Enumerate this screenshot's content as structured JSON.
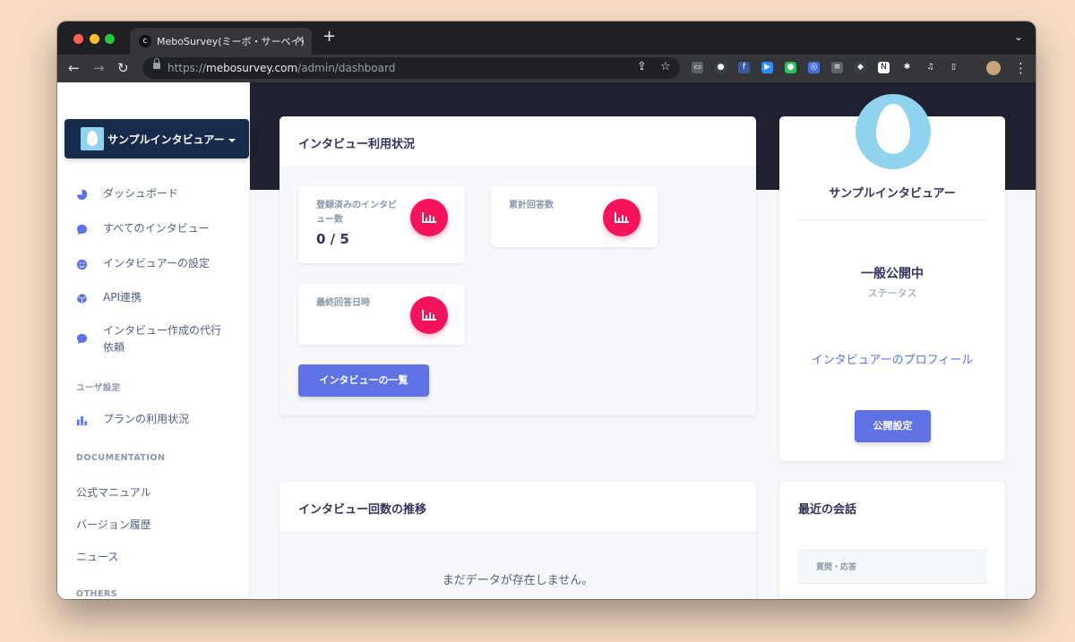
{
  "browser": {
    "tab_title": "MeboSurvey(ミーボ・サーベイ)",
    "tab_favicon": "c",
    "tab_close": "×",
    "new_tab": "+",
    "tab_search": "⌄",
    "url_scheme": "https://",
    "url_host": "mebosurvey.com",
    "url_path": "/admin/dashboard",
    "back_icon": "←",
    "forward_icon": "→",
    "reload_icon": "↻",
    "share_icon": "⇪",
    "star_icon": "☆",
    "menu_icon": "⋮",
    "extensions": [
      {
        "name": "screen-ext-icon",
        "glyph": "▭",
        "color": "#5f6368"
      },
      {
        "name": "circle-ext-icon",
        "glyph": "●",
        "color": "#3c4043"
      },
      {
        "name": "facebook-ext-icon",
        "glyph": "f",
        "color": "#3b5998"
      },
      {
        "name": "zoom-ext-icon",
        "glyph": "▶",
        "color": "#2d8cff"
      },
      {
        "name": "evernote-ext-icon",
        "glyph": "●",
        "color": "#2dbe60"
      },
      {
        "name": "swirl-ext-icon",
        "glyph": "◎",
        "color": "#4a6ee0"
      },
      {
        "name": "doc-ext-icon",
        "glyph": "≡",
        "color": "#5f6368"
      },
      {
        "name": "bot-ext-icon",
        "glyph": "◆",
        "color": "#3c4043"
      },
      {
        "name": "notion-ext-icon",
        "glyph": "N",
        "color": "#ffffff"
      },
      {
        "name": "puzzle-ext-icon",
        "glyph": "✱",
        "color": "#35363a"
      },
      {
        "name": "media-ext-icon",
        "glyph": "♫",
        "color": "#35363a"
      },
      {
        "name": "sidepanel-ext-icon",
        "glyph": "▯",
        "color": "#35363a"
      }
    ]
  },
  "sidebar": {
    "user_name": "サンプルインタビュアー",
    "items": [
      {
        "label": "ダッシュボード",
        "icon": "pie-chart-icon"
      },
      {
        "label": "すべてのインタビュー",
        "icon": "chat-bubble-icon"
      },
      {
        "label": "インタビュアーの設定",
        "icon": "smile-icon"
      },
      {
        "label": "API連携",
        "icon": "box-icon"
      },
      {
        "label": "インタビュー作成の代行\n依頼",
        "icon": "chat-bubble-icon"
      }
    ],
    "user_section": "ユーザ設定",
    "plan_item": {
      "label": "プランの利用状況",
      "icon": "bar-chart-icon"
    },
    "doc_section": "DOCUMENTATION",
    "doc_links": [
      "公式マニュアル",
      "バージョン履歴",
      "ニュース"
    ],
    "others_section": "OTHERS"
  },
  "usage_card": {
    "title": "インタビュー利用状況",
    "stats": [
      {
        "label": "登録済みのインタビュー数",
        "value": "0 / 5"
      },
      {
        "label": "累計回答数",
        "value": ""
      },
      {
        "label": "最終回答日時",
        "value": ""
      }
    ],
    "list_button": "インタビューの一覧"
  },
  "profile_card": {
    "name": "サンプルインタビュアー",
    "status": "一般公開中",
    "status_label": "ステータス",
    "profile_link": "インタビュアーのプロフィール",
    "settings_button": "公開設定"
  },
  "trend_card": {
    "title": "インタビュー回数の推移",
    "empty_message": "まだデータが存在しません。"
  },
  "recent_card": {
    "title": "最近の会話",
    "column_header": "質問・応答"
  }
}
